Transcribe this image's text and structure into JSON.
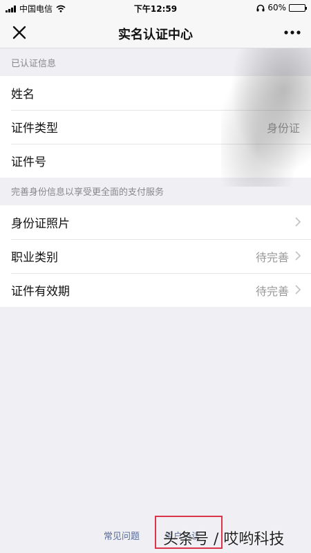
{
  "status_bar": {
    "carrier": "中国电信",
    "time": "下午12:59",
    "battery": "60%"
  },
  "nav": {
    "title": "实名认证中心"
  },
  "verified": {
    "header": "已认证信息",
    "rows": [
      {
        "label": "姓名",
        "value": ""
      },
      {
        "label": "证件类型",
        "value": "身份证"
      },
      {
        "label": "证件号",
        "value": ""
      }
    ]
  },
  "complete": {
    "header": "完善身份信息以享受更全面的支付服务",
    "rows": [
      {
        "label": "身份证照片",
        "value": ""
      },
      {
        "label": "职业类别",
        "value": "待完善"
      },
      {
        "label": "证件有效期",
        "value": "待完善"
      }
    ]
  },
  "footer": {
    "faq": "常见问题",
    "agreement": "用户协议"
  },
  "watermark": "头条号 / 哎哟科技"
}
